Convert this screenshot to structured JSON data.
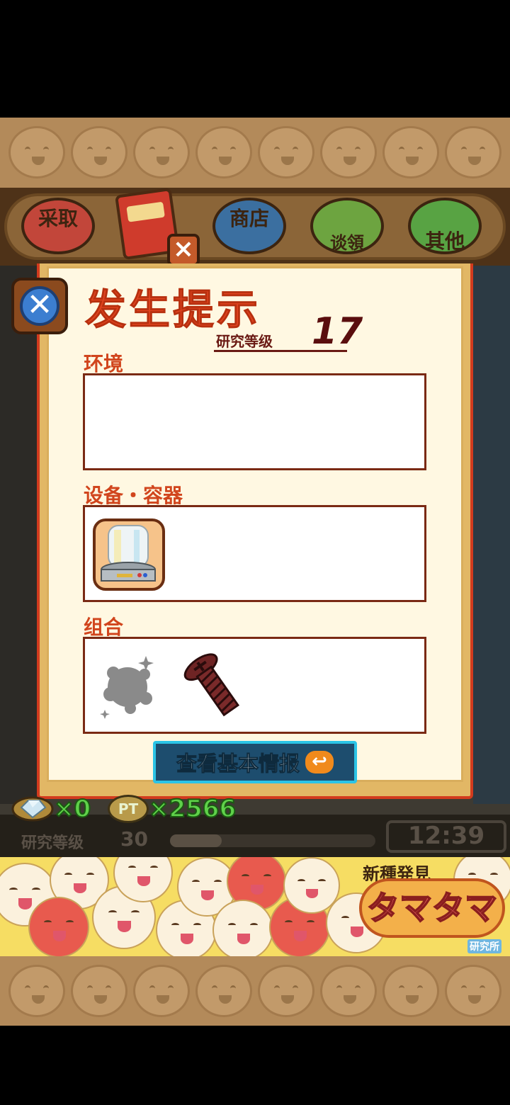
{
  "tabs": {
    "collect": "采取",
    "shop": "商店",
    "gift": "谈領",
    "other": "其他",
    "note_icon": "notebook-icon",
    "close_icon": "close-icon"
  },
  "dialog": {
    "title": "发生提示",
    "level_label": "研究等级",
    "level_value": "17",
    "environment_label": "环境",
    "equipment_label": "设备・容器",
    "combination_label": "组合",
    "basic_info_button": "查看基本情报",
    "equipment_items": [
      "glass-dome-container-icon"
    ],
    "combination_items": [
      "gray-dust-icon",
      "screw-icon"
    ]
  },
  "resources": {
    "gem_count": "×0",
    "pt_badge": "PT",
    "pt_count": "×2566"
  },
  "status": {
    "level_label": "研究等级",
    "level_value": "30",
    "progress": 0.25,
    "clock": "12:39"
  },
  "banner": {
    "top_text": "新種発見",
    "title": "タマタマ",
    "subtitle": "研究所"
  },
  "colors": {
    "accent": "#e0431f",
    "panel": "#fff8e2",
    "button": "#1d4d6e",
    "resource": "#5fd14a"
  }
}
